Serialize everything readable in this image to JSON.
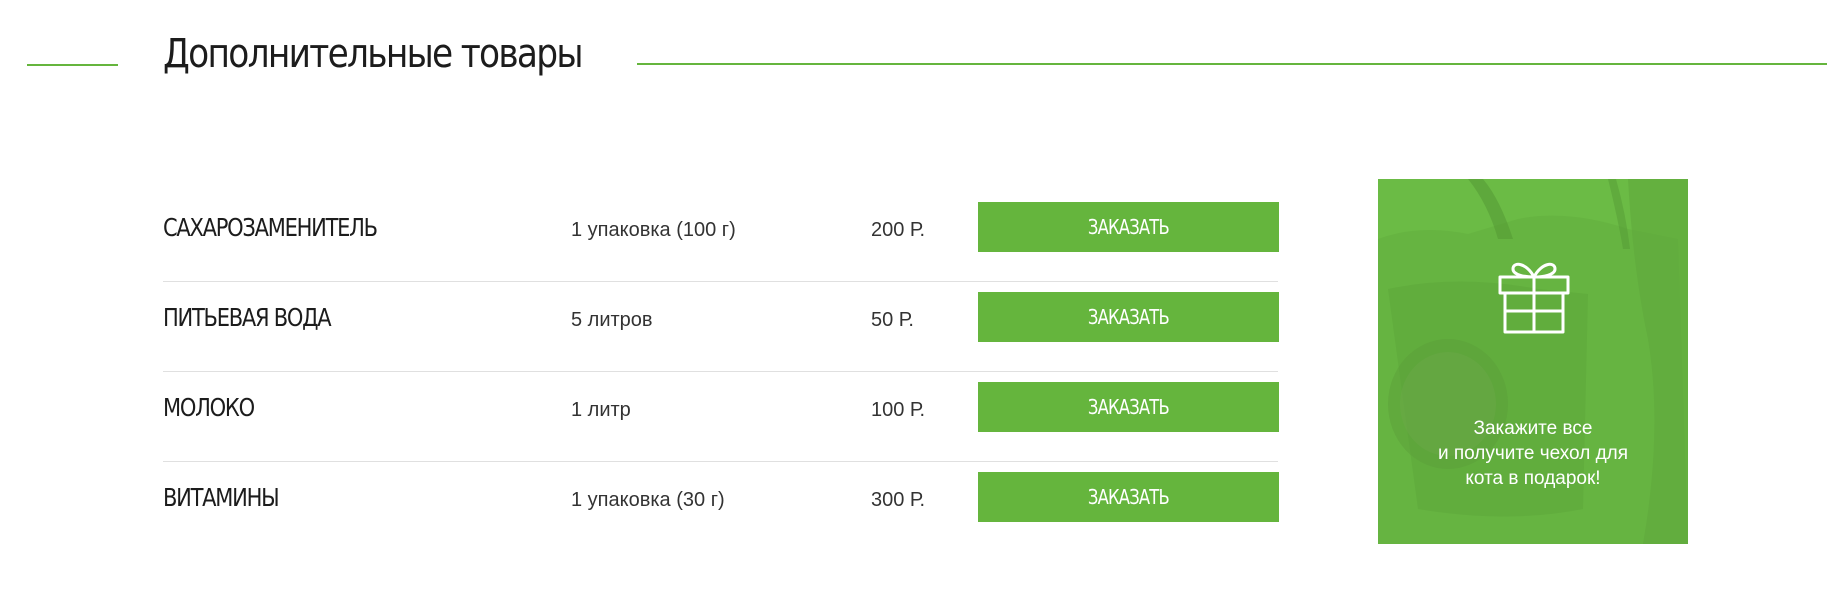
{
  "section": {
    "title": "Дополнительные товары"
  },
  "products": [
    {
      "name": "САХАРОЗАМЕНИТЕЛЬ",
      "quantity": "1 упаковка (100 г)",
      "price": "200 Р.",
      "button": "ЗАКАЗАТЬ"
    },
    {
      "name": "ПИТЬЕВАЯ ВОДА",
      "quantity": "5 литров",
      "price": "50 Р.",
      "button": "ЗАКАЗАТЬ"
    },
    {
      "name": "МОЛОКО",
      "quantity": "1 литр",
      "price": "100 Р.",
      "button": "ЗАКАЗАТЬ"
    },
    {
      "name": "ВИТАМИНЫ",
      "quantity": "1 упаковка (30 г)",
      "price": "300 Р.",
      "button": "ЗАКАЗАТЬ"
    }
  ],
  "promo": {
    "icon": "gift-icon",
    "lines": [
      "Закажите все",
      "и получите чехол для",
      "кота в подарок!"
    ]
  },
  "colors": {
    "accent": "#65b53d",
    "divider": "#e0e0e0",
    "text": "#1c1c1c"
  }
}
